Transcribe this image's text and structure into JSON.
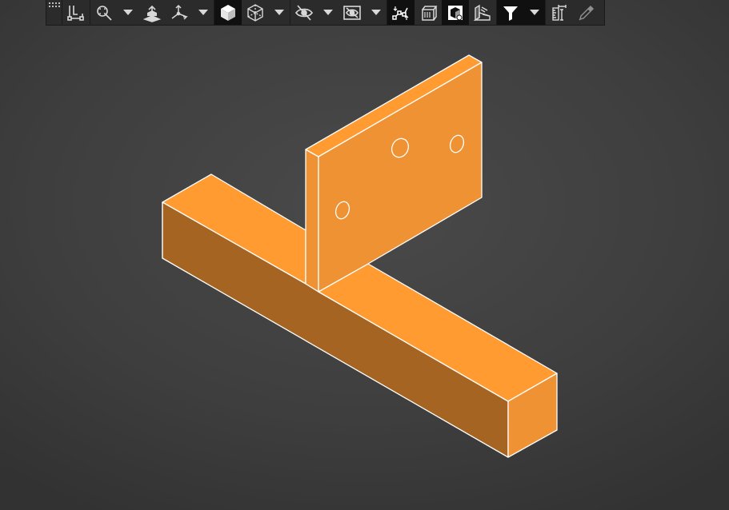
{
  "toolbar": {
    "items": [
      {
        "icon": "toolbar-grip-icon"
      },
      {
        "icon": "sketch-icon"
      },
      {
        "icon": "zoom-fit-icon"
      },
      {
        "icon": "chevron-down-icon"
      },
      {
        "icon": "section-view-icon"
      },
      {
        "icon": "view-orientation-icon"
      },
      {
        "icon": "chevron-down-icon"
      },
      {
        "icon": "shaded-display-icon",
        "active": true
      },
      {
        "icon": "wireframe-display-icon"
      },
      {
        "icon": "chevron-down-icon"
      },
      {
        "icon": "hide-show-icon"
      },
      {
        "icon": "view-settings-icon"
      },
      {
        "icon": "chevron-down-icon"
      },
      {
        "icon": "show-sketch-dimensions-icon",
        "active": true
      },
      {
        "icon": "scene-icon"
      },
      {
        "icon": "appearance-icon",
        "active": true
      },
      {
        "icon": "display-states-icon"
      },
      {
        "icon": "selection-filter-icon",
        "active": true
      },
      {
        "icon": "chevron-down-icon",
        "active": true
      },
      {
        "icon": "measure-icon"
      },
      {
        "icon": "color-picker-icon"
      }
    ]
  },
  "model": {
    "part": "t-bracket",
    "face_color_light": "#FF9B30",
    "face_color_mid": "#EE9233",
    "face_color_dark": "#A56421",
    "edge_color": "#FFFFFF",
    "holes": 3
  },
  "colors": {
    "background": "#434343",
    "toolbar": "#2B2B2B",
    "icon": "#D8D8D8"
  }
}
